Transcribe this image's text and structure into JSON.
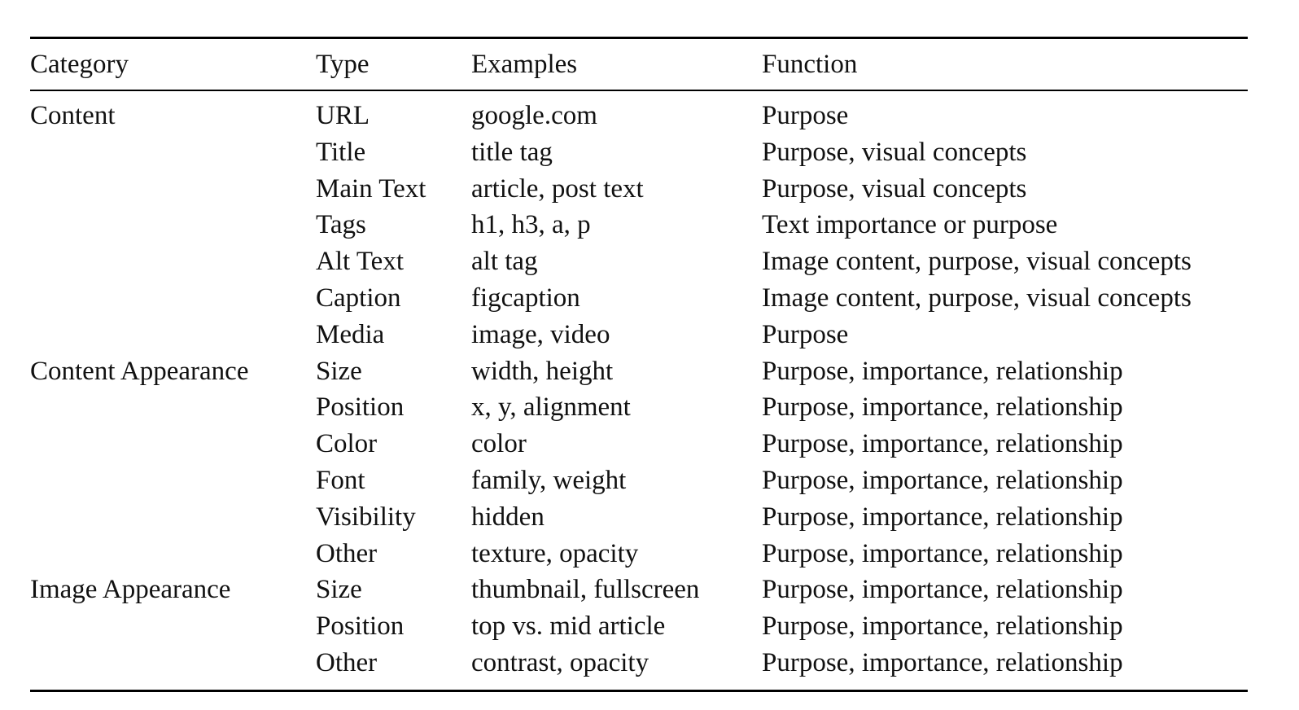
{
  "table": {
    "headers": [
      "Category",
      "Type",
      "Examples",
      "Function"
    ],
    "rows": [
      {
        "category": "Content",
        "type": "URL",
        "examples": "google.com",
        "function": "Purpose"
      },
      {
        "category": "",
        "type": "Title",
        "examples": "title tag",
        "function": "Purpose, visual concepts"
      },
      {
        "category": "",
        "type": "Main Text",
        "examples": "article, post text",
        "function": "Purpose, visual concepts"
      },
      {
        "category": "",
        "type": "Tags",
        "examples": "h1, h3, a, p",
        "function": "Text importance or purpose"
      },
      {
        "category": "",
        "type": "Alt Text",
        "examples": "alt tag",
        "function": "Image content, purpose, visual concepts"
      },
      {
        "category": "",
        "type": "Caption",
        "examples": "figcaption",
        "function": "Image content, purpose, visual concepts"
      },
      {
        "category": "",
        "type": "Media",
        "examples": "image, video",
        "function": "Purpose"
      },
      {
        "category": "Content Appearance",
        "type": "Size",
        "examples": "width, height",
        "function": "Purpose, importance, relationship"
      },
      {
        "category": "",
        "type": "Position",
        "examples": "x, y, alignment",
        "function": "Purpose, importance, relationship"
      },
      {
        "category": "",
        "type": "Color",
        "examples": "color",
        "function": "Purpose, importance, relationship"
      },
      {
        "category": "",
        "type": "Font",
        "examples": "family, weight",
        "function": "Purpose, importance, relationship"
      },
      {
        "category": "",
        "type": "Visibility",
        "examples": "hidden",
        "function": "Purpose, importance, relationship"
      },
      {
        "category": "",
        "type": "Other",
        "examples": "texture, opacity",
        "function": "Purpose, importance, relationship"
      },
      {
        "category": "Image Appearance",
        "type": "Size",
        "examples": "thumbnail, fullscreen",
        "function": "Purpose, importance, relationship"
      },
      {
        "category": "",
        "type": "Position",
        "examples": "top vs. mid article",
        "function": "Purpose, importance, relationship"
      },
      {
        "category": "",
        "type": "Other",
        "examples": "contrast, opacity",
        "function": "Purpose, importance, relationship"
      }
    ]
  }
}
